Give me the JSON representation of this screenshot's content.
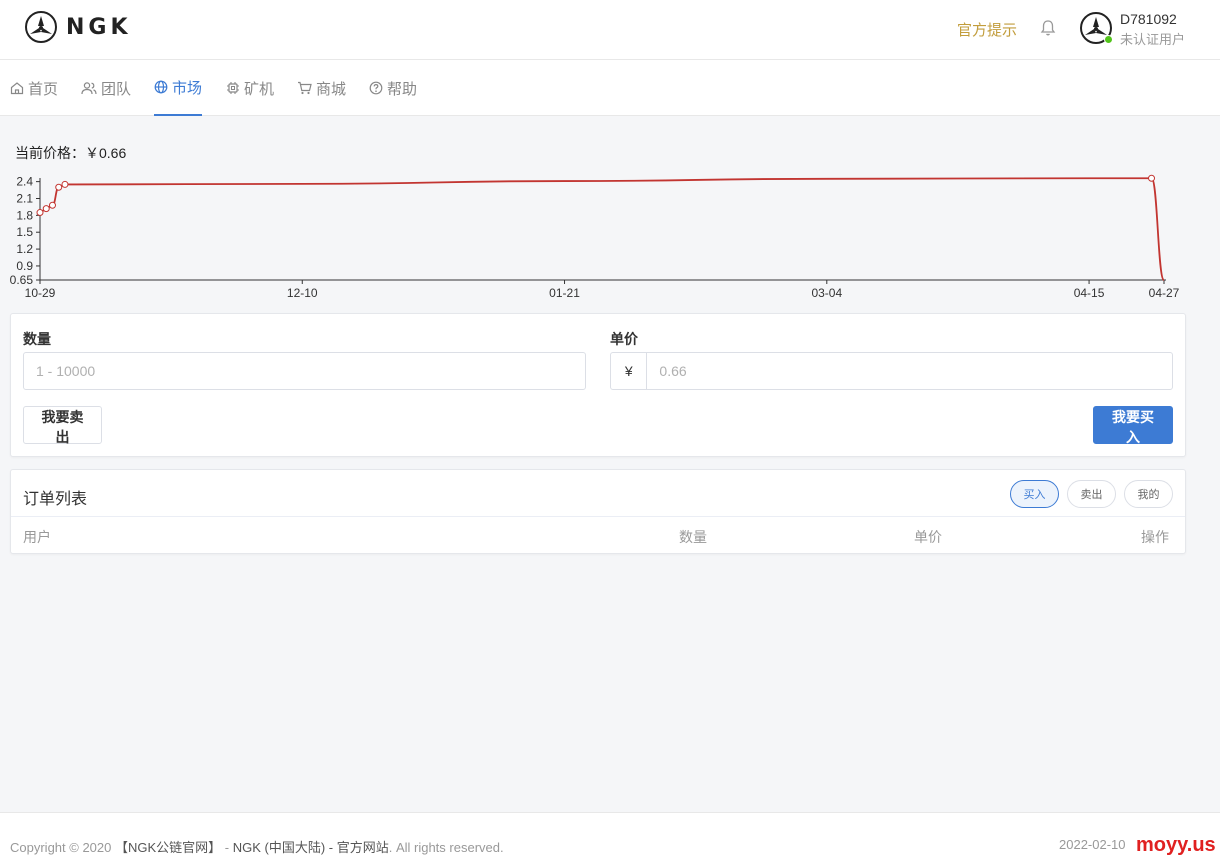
{
  "header": {
    "logo_text": "NGK",
    "notice_link": "官方提示",
    "user_id": "D781092",
    "user_status": "未认证用户"
  },
  "nav": {
    "items": [
      {
        "label": "首页",
        "icon": "home-icon"
      },
      {
        "label": "团队",
        "icon": "team-icon"
      },
      {
        "label": "市场",
        "icon": "globe-icon",
        "active": true
      },
      {
        "label": "矿机",
        "icon": "chip-icon"
      },
      {
        "label": "商城",
        "icon": "cart-icon"
      },
      {
        "label": "帮助",
        "icon": "help-icon"
      }
    ]
  },
  "market": {
    "current_price_label": "当前价格：",
    "current_price_value": "￥0.66"
  },
  "chart_data": {
    "type": "line",
    "title": "",
    "xlabel": "",
    "ylabel": "",
    "x_ticks": [
      "10-29",
      "12-10",
      "01-21",
      "03-04",
      "04-15",
      "04-27"
    ],
    "y_ticks": [
      "2.4",
      "2.1",
      "1.8",
      "1.5",
      "1.2",
      "0.9",
      "0.65"
    ],
    "ylim": [
      0.65,
      2.5
    ],
    "grid": false,
    "legend": "none",
    "color": "#c23531",
    "series": [
      {
        "x": [
          "10-29",
          "10-30",
          "10-31",
          "11-01",
          "11-02",
          "11-03",
          "12-10",
          "01-21",
          "03-04",
          "04-15",
          "04-25",
          "04-27"
        ],
        "y": [
          1.85,
          1.92,
          1.98,
          2.3,
          2.35,
          2.35,
          2.36,
          2.41,
          2.45,
          2.46,
          2.46,
          0.65
        ],
        "markers": [
          true,
          true,
          true,
          true,
          true,
          false,
          false,
          false,
          false,
          false,
          true,
          false
        ]
      }
    ]
  },
  "trade": {
    "quantity_label": "数量",
    "quantity_placeholder": "1 - 10000",
    "price_label": "单价",
    "price_prefix": "¥",
    "price_placeholder": "0.66",
    "sell_button": "我要卖出",
    "buy_button": "我要买入"
  },
  "orders": {
    "title": "订单列表",
    "filters": [
      {
        "label": "买入",
        "active": true
      },
      {
        "label": "卖出",
        "active": false
      },
      {
        "label": "我的",
        "active": false
      }
    ],
    "columns": [
      "用户",
      "数量",
      "单价",
      "操作"
    ]
  },
  "footer": {
    "copyright_prefix": "Copyright © 2020",
    "site_name": "【NGK公链官网】",
    "separator": " - ",
    "region": "NGK (中国大陆) - 官方网站",
    "rights": ". All rights reserved.",
    "date": "2022-02-10",
    "watermark": "moyy.us"
  },
  "colors": {
    "accent": "#3d7bd4",
    "notice": "#c29d3c",
    "chart_line": "#c23531",
    "online": "#52c41a"
  }
}
